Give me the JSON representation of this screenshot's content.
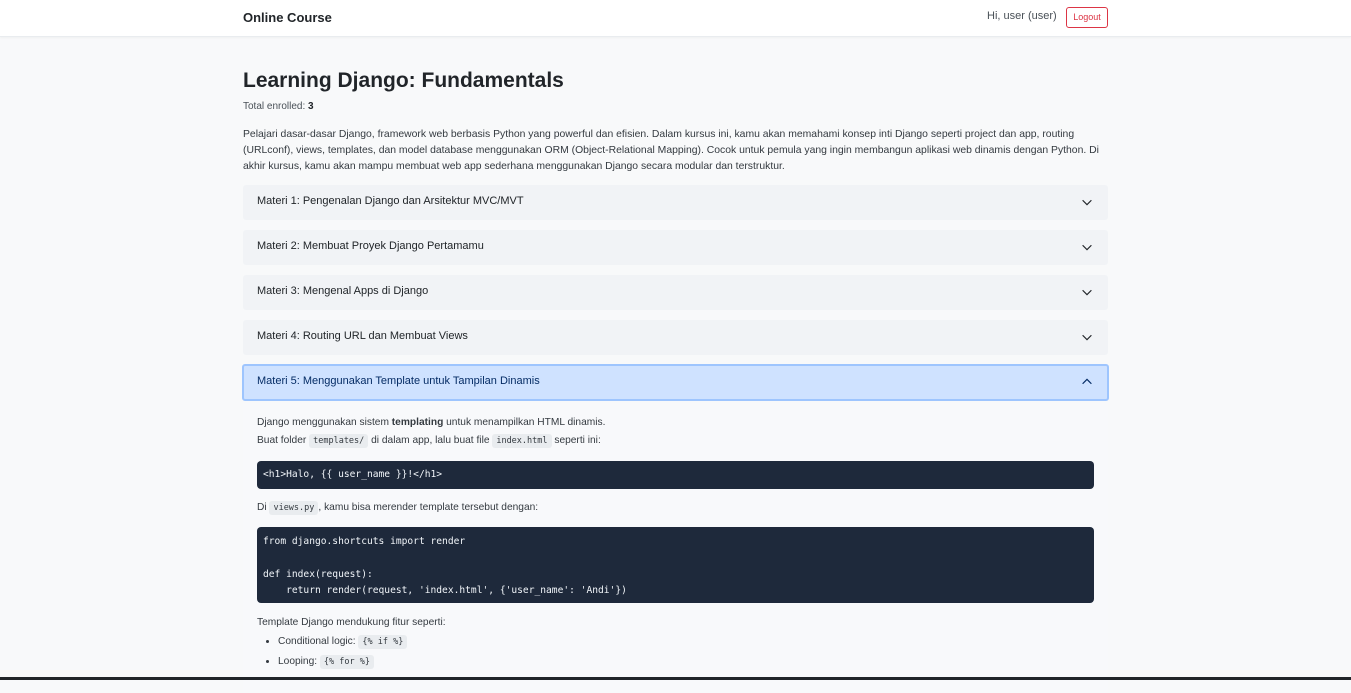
{
  "navbar": {
    "brand": "Online Course",
    "greeting": "Hi, user (user)",
    "logout_label": "Logout"
  },
  "course": {
    "title": "Learning Django: Fundamentals",
    "enrolled_label": "Total enrolled: ",
    "enrolled_count": "3",
    "description": "Pelajari dasar-dasar Django, framework web berbasis Python yang powerful dan efisien. Dalam kursus ini, kamu akan memahami konsep inti Django seperti project dan app, routing (URLconf), views, templates, dan model database menggunakan ORM (Object-Relational Mapping). Cocok untuk pemula yang ingin membangun aplikasi web dinamis dengan Python. Di akhir kursus, kamu akan mampu membuat web app sederhana menggunakan Django secara modular dan terstruktur."
  },
  "materials": [
    {
      "label": "Materi 1: Pengenalan Django dan Arsitektur MVC/MVT",
      "expanded": false
    },
    {
      "label": "Materi 2: Membuat Proyek Django Pertamamu",
      "expanded": false
    },
    {
      "label": "Materi 3: Mengenal Apps di Django",
      "expanded": false
    },
    {
      "label": "Materi 4: Routing URL dan Membuat Views",
      "expanded": false
    },
    {
      "label": "Materi 5: Menggunakan Template untuk Tampilan Dinamis",
      "expanded": true
    }
  ],
  "content": {
    "p1_before": "Django menggunakan sistem ",
    "p1_bold": "templating",
    "p1_after": " untuk menampilkan HTML dinamis.",
    "p2_before": "Buat folder ",
    "p2_code1": "templates/",
    "p2_mid": " di dalam app, lalu buat file ",
    "p2_code2": "index.html",
    "p2_after": " seperti ini:",
    "code1": "<h1>Halo, {{ user_name }}!</h1>",
    "p3_before": "Di ",
    "p3_code": "views.py",
    "p3_after": ", kamu bisa merender template tersebut dengan:",
    "code2": "from django.shortcuts import render\n\ndef index(request):\n    return render(request, 'index.html', {'user_name': 'Andi'})",
    "p4": "Template Django mendukung fitur seperti:",
    "features": [
      {
        "label": "Conditional logic: ",
        "code": "{% if %}"
      },
      {
        "label": "Looping: ",
        "code": "{% for %}"
      }
    ]
  }
}
